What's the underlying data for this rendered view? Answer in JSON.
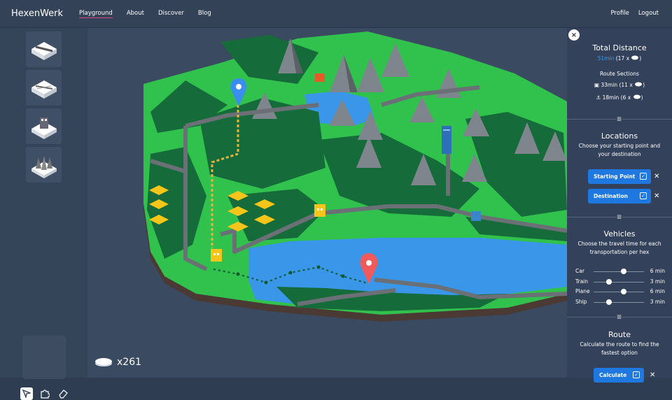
{
  "brand": "HexenWerk",
  "nav": [
    "Playground",
    "About",
    "Discover",
    "Blog"
  ],
  "user_nav": [
    "Profile",
    "Logout"
  ],
  "coins": "x261",
  "tile_buttons": [
    "road-tile",
    "rail-tile",
    "town-tile",
    "mountain-tile"
  ],
  "tools": [
    "cursor-icon",
    "puzzle-icon",
    "eraser-icon"
  ],
  "panel": {
    "close": "×",
    "total_title": "Total Distance",
    "total_time": "51min",
    "total_extra": "(17 x",
    "sections_title": "Route Sections",
    "sections": [
      {
        "icon": "train-icon",
        "text": "33min (11 x"
      },
      {
        "icon": "ship-icon",
        "text": "18min (6 x"
      }
    ],
    "locations_title": "Locations",
    "locations_desc": "Choose your starting point and your destination",
    "starting_label": "Starting Point",
    "destination_label": "Destination",
    "vehicles_title": "Vehicles",
    "vehicles_desc": "Choose the travel time for each transportation per hex",
    "vehicles": [
      {
        "name": "Car",
        "value": "6 min",
        "level": 0.6
      },
      {
        "name": "Train",
        "value": "3 min",
        "level": 0.3
      },
      {
        "name": "Plane",
        "value": "6 min",
        "level": 0.6
      },
      {
        "name": "Ship",
        "value": "3 min",
        "level": 0.3
      }
    ],
    "route_title": "Route",
    "route_desc": "Calculate the route to find the fastest option",
    "calculate_label": "Calculate"
  }
}
